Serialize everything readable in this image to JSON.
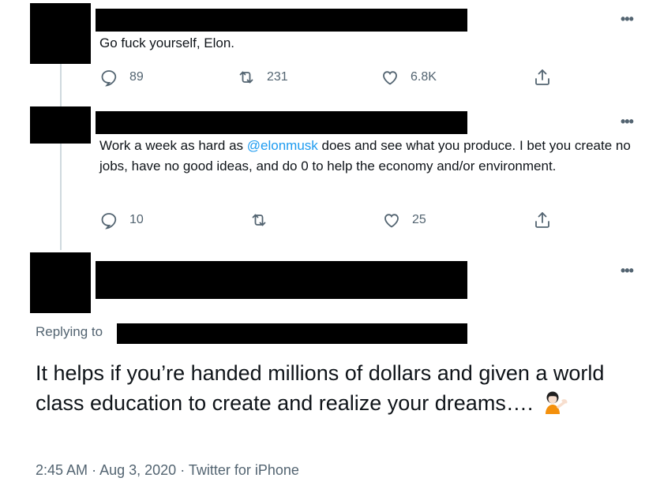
{
  "tweet1": {
    "text": "Go fuck yourself, Elon.",
    "replies": "89",
    "retweets": "231",
    "likes": "6.8K",
    "more_icon": "more-horizontal-icon"
  },
  "tweet2": {
    "text_before": "Work a week as hard as ",
    "mention": "@elonmusk",
    "text_after": " does and see what you produce. I bet you create no jobs, have no good ideas, and do 0 to help the economy and/or environment.",
    "replies": "10",
    "retweets": "",
    "likes": "25"
  },
  "main": {
    "replying_label": "Replying to",
    "text": "It helps if you’re handed millions of dollars and given a world class education to create and realize your dreams….",
    "emoji": "person-tipping-hand-emoji",
    "time": "2:45 AM",
    "date": "Aug 3, 2020",
    "client": "Twitter for iPhone",
    "separator": "·"
  },
  "colors": {
    "accent": "#1d9bf0",
    "muted": "#536471",
    "thread_line": "#cfd9de"
  }
}
